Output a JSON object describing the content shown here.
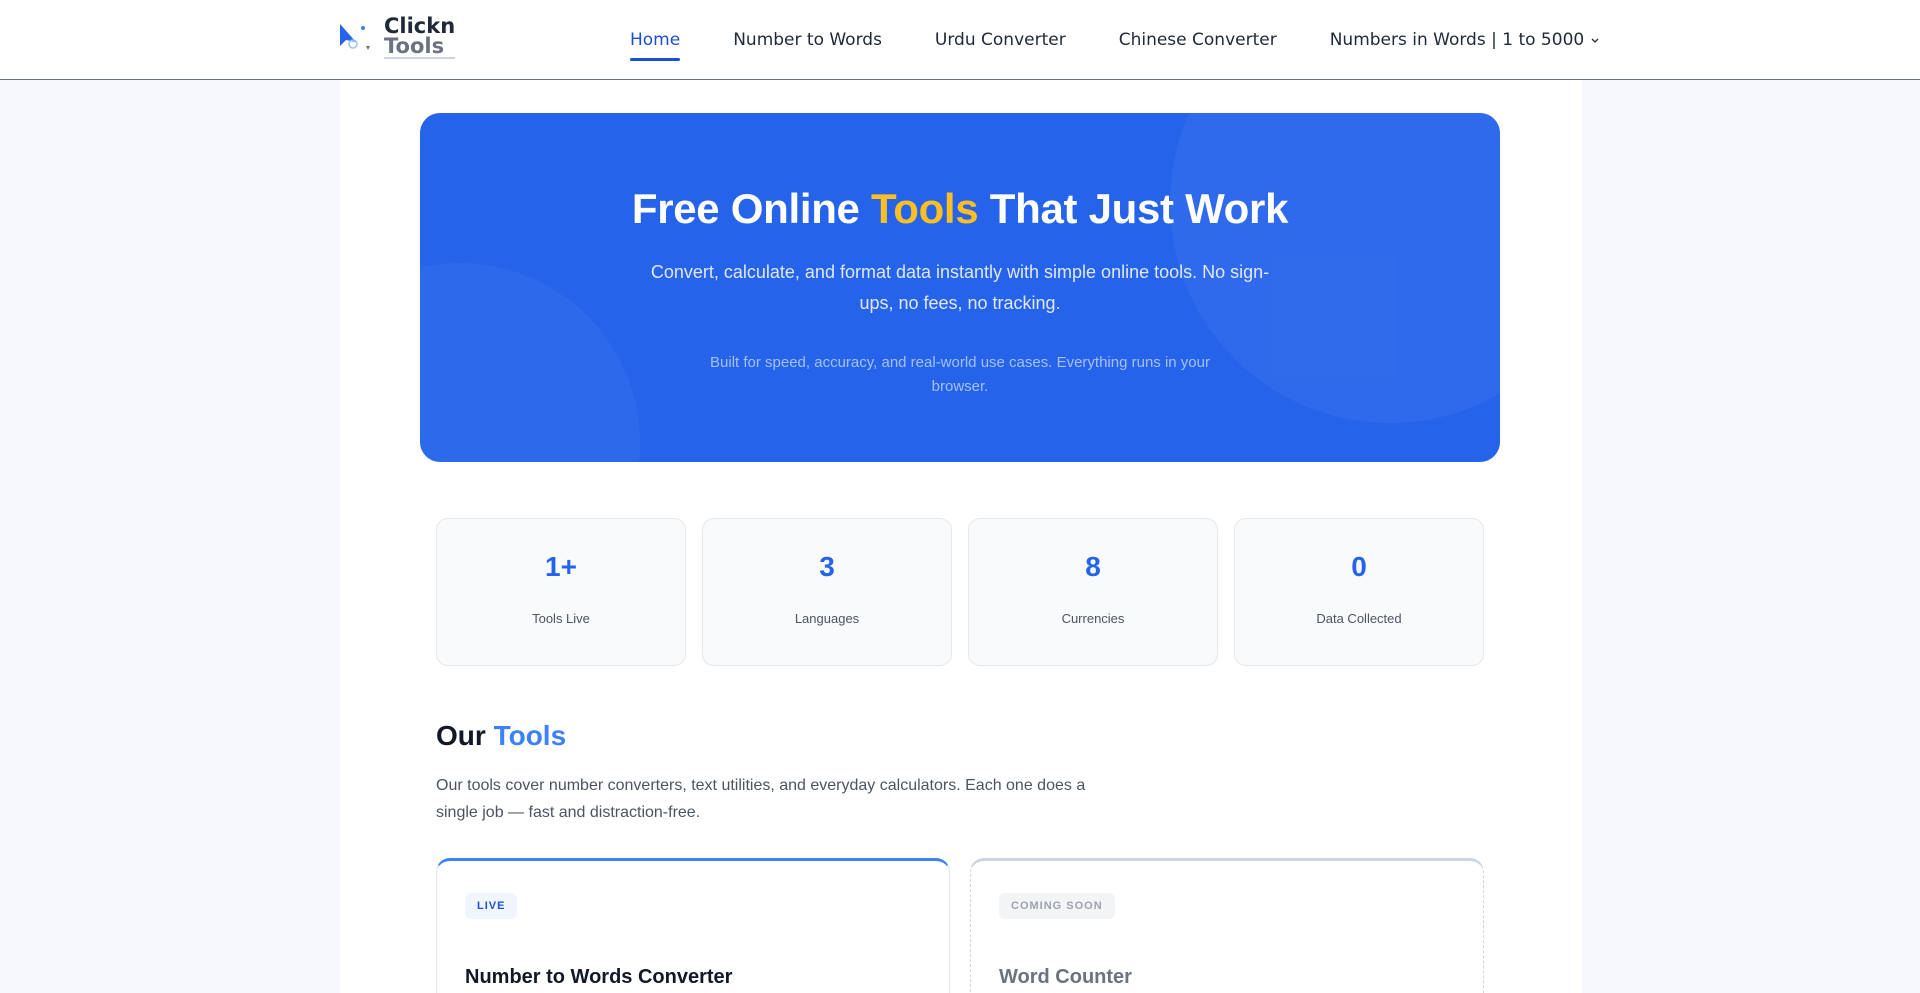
{
  "brand": {
    "line1": "Clickn",
    "line2": "Tools"
  },
  "nav": {
    "items": [
      {
        "label": "Home",
        "active": true
      },
      {
        "label": "Number to Words"
      },
      {
        "label": "Urdu Converter"
      },
      {
        "label": "Chinese Converter"
      },
      {
        "label": "Numbers in Words | 1 to 5000",
        "has_dropdown": true
      }
    ]
  },
  "hero": {
    "title_before": "Free Online ",
    "title_accent": "Tools",
    "title_after": " That Just Work",
    "subtitle": "Convert, calculate, and format data instantly with simple online tools. No sign-ups, no fees, no tracking.",
    "note": "Built for speed, accuracy, and real-world use cases. Everything runs in your browser."
  },
  "stats": [
    {
      "value": "1+",
      "label": "Tools Live"
    },
    {
      "value": "3",
      "label": "Languages"
    },
    {
      "value": "8",
      "label": "Currencies"
    },
    {
      "value": "0",
      "label": "Data Collected"
    }
  ],
  "tools_section": {
    "title_plain": "Our ",
    "title_accent": "Tools",
    "description": "Our tools cover number converters, text utilities, and everyday calculators. Each one does a single job — fast and distraction-free.",
    "cards": [
      {
        "badge": "LIVE",
        "name": "Number to Words Converter"
      },
      {
        "badge": "COMING SOON",
        "name": "Word Counter"
      }
    ]
  },
  "colors": {
    "primary": "#2563eb",
    "accent_yellow": "#fbbf24",
    "link_active": "#1d4ed8"
  }
}
